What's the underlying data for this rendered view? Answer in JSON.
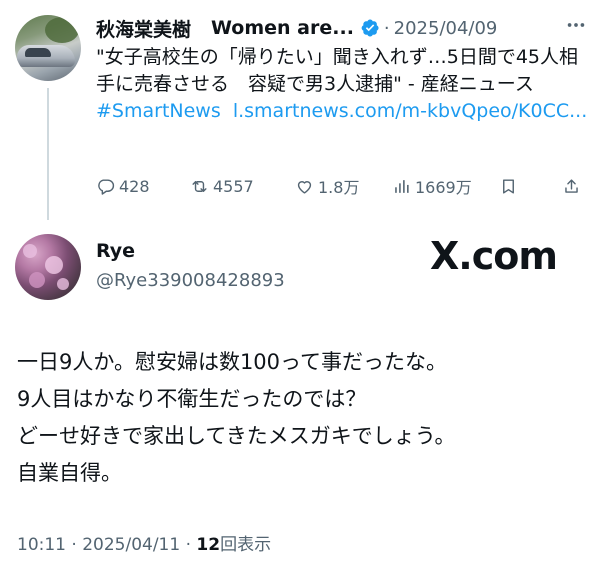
{
  "parent_tweet": {
    "display_name": "秋海棠美樹",
    "handle_truncated": "Women are...",
    "separator": "·",
    "date": "2025/04/09",
    "text_plain": "\"女子高校生の「帰りたい」聞き入れず…5日間で45人相手に売春させる　容疑で男3人逮捕\" - 産経ニュース ",
    "hashtag": "#SmartNews",
    "link": "l.smartnews.com/m-kbvQpeo/K0CC...",
    "replies": "428",
    "reposts": "4557",
    "likes": "1.8万",
    "views": "1669万"
  },
  "reply_tweet": {
    "display_name": "Rye",
    "handle": "@Rye339008428893",
    "watermark": "X.com",
    "lines": [
      "一日9人か。慰安婦は数100って事だったな。",
      "9人目はかなり不衛生だったのでは？",
      "どーせ好きで家出してきたメスガキでしょう。",
      "自業自得。"
    ],
    "timestamp": "10:11 · 2025/04/11 · ",
    "view_count": "12",
    "view_label": "回表示"
  },
  "colors": {
    "text": "#0f1419",
    "secondary": "#536471",
    "link": "#1d9bf0",
    "verified": "#1d9bf0"
  },
  "icons": [
    "more-icon",
    "verified-icon",
    "reply-icon",
    "repost-icon",
    "like-icon",
    "views-icon",
    "bookmark-icon",
    "share-icon"
  ]
}
